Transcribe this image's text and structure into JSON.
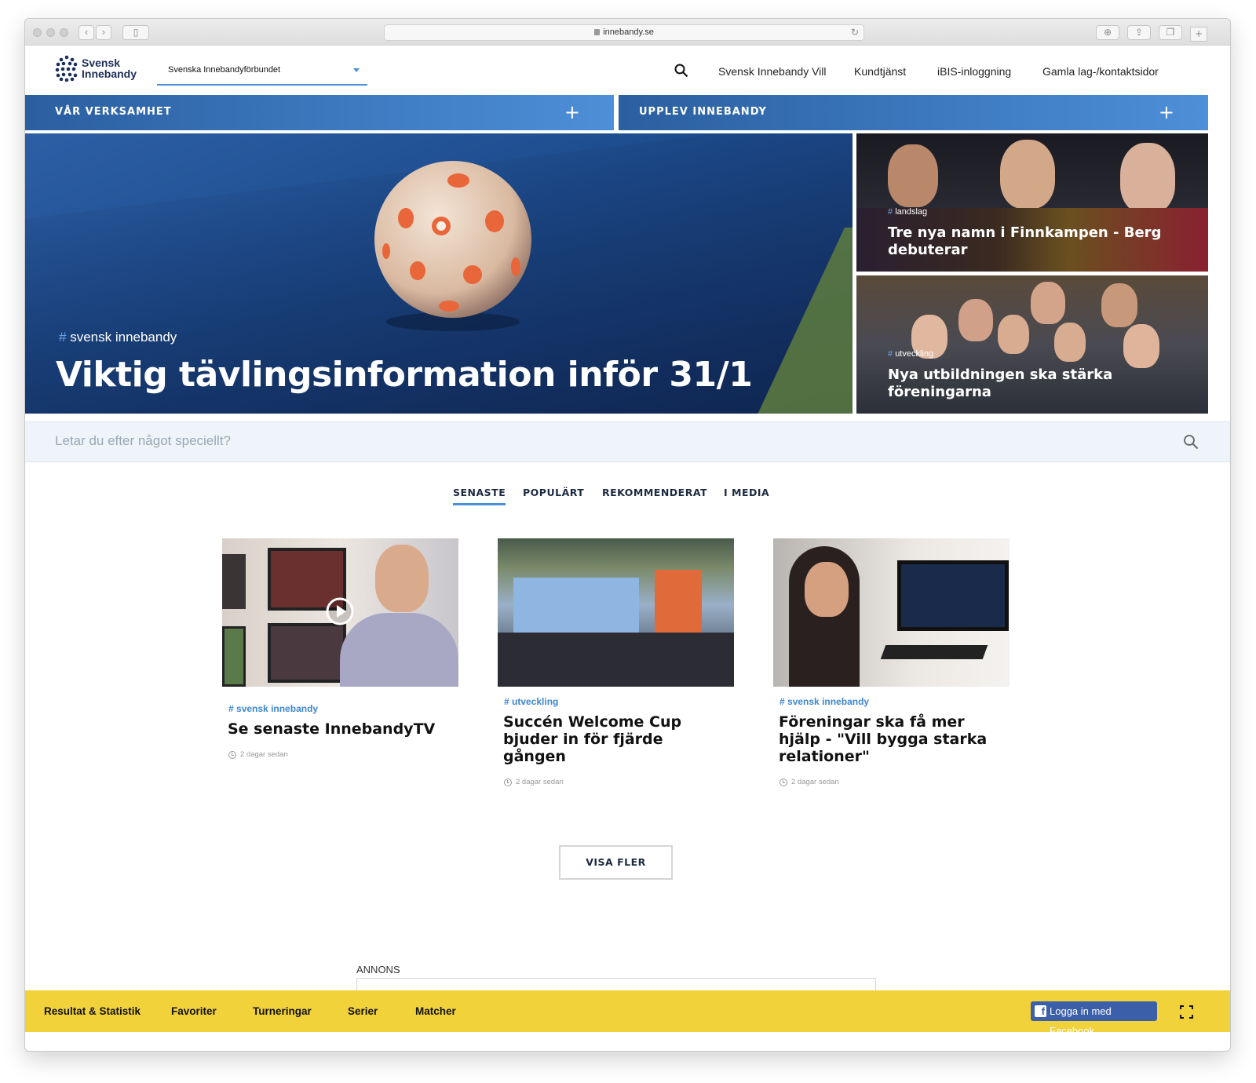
{
  "browser": {
    "url": "innebandy.se"
  },
  "header": {
    "logo_line1": "Svensk",
    "logo_line2": "Innebandy",
    "federation_select": "Svenska Innebandyförbundet",
    "nav": [
      "Svensk Innebandy Vill",
      "Kundtjänst",
      "iBIS-inloggning",
      "Gamla lag-/kontaktsidor"
    ]
  },
  "menubars": {
    "left": "VÅR VERKSAMHET",
    "right": "UPPLEV INNEBANDY",
    "plus": "+"
  },
  "hero": {
    "tag": "svensk innebandy",
    "title": "Viktig tävlingsinformation inför 31/1"
  },
  "side_tiles": [
    {
      "tag": "landslag",
      "title": "Tre nya namn i Finnkampen - Berg debuterar"
    },
    {
      "tag": "utveckling",
      "title": "Nya utbildningen ska stärka föreningarna"
    }
  ],
  "search": {
    "placeholder": "Letar du efter något speciellt?"
  },
  "tabs": [
    "SENASTE",
    "POPULÄRT",
    "REKOMMENDERAT",
    "I MEDIA"
  ],
  "hash": "#",
  "cards": [
    {
      "tag": "svensk innebandy",
      "title": "Se senaste InnebandyTV",
      "time": "2 dagar sedan"
    },
    {
      "tag": "utveckling",
      "title": "Succén Welcome Cup bjuder in för fjärde gången",
      "time": "2 dagar sedan"
    },
    {
      "tag": "svensk innebandy",
      "title": "Föreningar ska få mer hjälp - \"Vill bygga starka relationer\"",
      "time": "2 dagar sedan"
    }
  ],
  "show_more": "VISA FLER",
  "ad_label": "ANNONS",
  "bottombar": {
    "links": [
      "Resultat & Statistik",
      "Favoriter",
      "Turneringar",
      "Serier",
      "Matcher"
    ],
    "facebook_login": "Logga in med Facebook",
    "facebook_glyph": "f"
  },
  "colors": {
    "accent_blue": "#4a8fd6",
    "navy": "#1c2f5a",
    "bottom_bar": "#f2d23a",
    "facebook": "#3b5fa8"
  }
}
